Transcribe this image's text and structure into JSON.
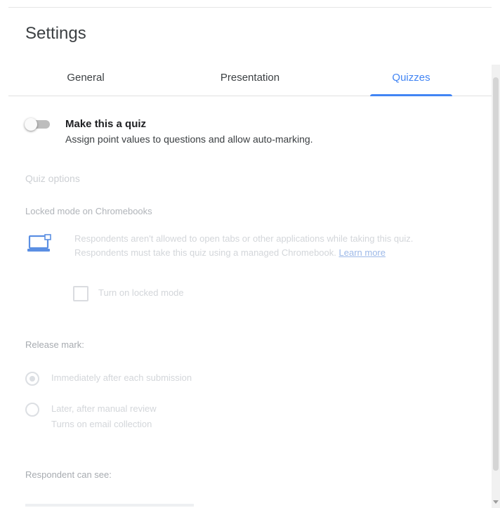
{
  "dialog": {
    "title": "Settings"
  },
  "tabs": [
    {
      "label": "General",
      "active": false
    },
    {
      "label": "Presentation",
      "active": false
    },
    {
      "label": "Quizzes",
      "active": true
    }
  ],
  "quiz": {
    "toggle_on": false,
    "title": "Make this a quiz",
    "description": "Assign point values to questions and allow auto-marking."
  },
  "quiz_options": {
    "heading": "Quiz options",
    "locked_mode": {
      "heading": "Locked mode on Chromebooks",
      "text": "Respondents aren't allowed to open tabs or other applications while taking this quiz. Respondents must take this quiz using a managed Chromebook.",
      "link": "Learn more",
      "checkbox_label": "Turn on locked mode",
      "checked": false
    },
    "release_mark": {
      "heading": "Release mark:",
      "options": [
        {
          "label": "Immediately after each submission",
          "selected": true
        },
        {
          "label": "Later, after manual review",
          "sublabel": "Turns on email collection",
          "selected": false
        }
      ]
    },
    "respondent": {
      "heading": "Respondent can see:"
    }
  },
  "colors": {
    "accent": "#4285f4",
    "text": "#202124",
    "disabled": "#d3d6da"
  }
}
